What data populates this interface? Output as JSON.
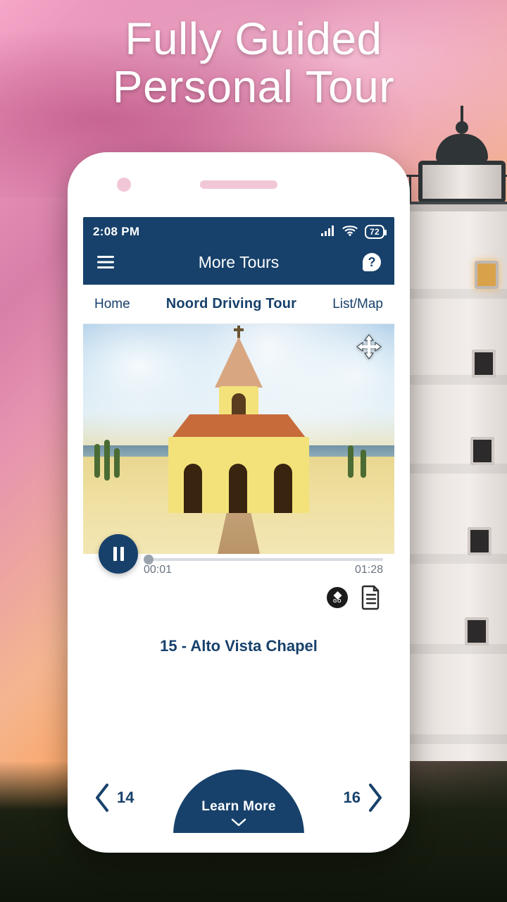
{
  "marketing": {
    "headline_line1": "Fully Guided",
    "headline_line2": "Personal Tour"
  },
  "statusbar": {
    "time": "2:08 PM",
    "battery_pct": "72"
  },
  "titlebar": {
    "title": "More Tours",
    "help_glyph": "?"
  },
  "navrow": {
    "home_label": "Home",
    "tour_name": "Noord Driving Tour",
    "toggle_label": "List/Map"
  },
  "player": {
    "current_time": "00:01",
    "total_time": "01:28",
    "go_label": "GO"
  },
  "poi": {
    "title": "15 - Alto Vista Chapel"
  },
  "bottom_nav": {
    "prev_number": "14",
    "next_number": "16",
    "learn_more_label": "Learn More"
  },
  "colors": {
    "brand_navy": "#17416b"
  }
}
